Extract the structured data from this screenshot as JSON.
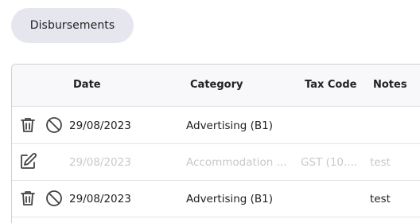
{
  "tab": {
    "label": "Disbursements"
  },
  "table": {
    "headers": {
      "date": "Date",
      "category": "Category",
      "tax_code": "Tax Code",
      "notes": "Notes"
    },
    "rows": [
      {
        "date": "29/08/2023",
        "category": "Advertising (B1)",
        "tax_code": "",
        "notes": ""
      },
      {
        "date": "29/08/2023",
        "category": "Accommodation ...",
        "tax_code": "GST (10....",
        "notes": "test"
      },
      {
        "date": "29/08/2023",
        "category": "Advertising (B1)",
        "tax_code": "",
        "notes": "test"
      }
    ]
  },
  "colors": {
    "pill_bg": "#e6e7ee",
    "icon": "#444444",
    "disabled_text": "#c9c9cc"
  }
}
